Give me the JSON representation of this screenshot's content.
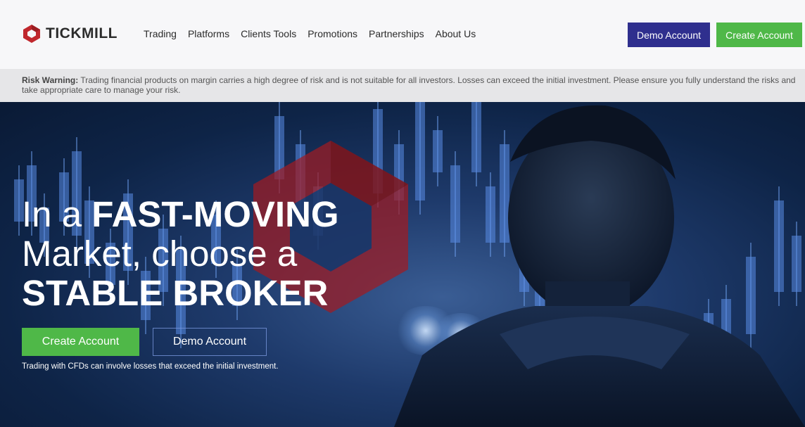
{
  "header": {
    "logo_text": "TICKMILL",
    "nav": [
      "Trading",
      "Platforms",
      "Clients Tools",
      "Promotions",
      "Partnerships",
      "About Us"
    ],
    "demo_label": "Demo Account",
    "create_label": "Create Account"
  },
  "risk": {
    "label": "Risk Warning:",
    "text": "Trading financial products on margin carries a high degree of risk and is not suitable for all investors. Losses can exceed the initial investment. Please ensure you fully understand the risks and take appropriate care to manage your risk."
  },
  "hero": {
    "line1_regular": "In a ",
    "line1_bold": "FAST-MOVING",
    "line2": "Market, choose a",
    "line3": "STABLE BROKER",
    "create_label": "Create Account",
    "demo_label": "Demo Account",
    "disclaimer": "Trading with CFDs can involve losses that exceed the initial investment."
  },
  "colors": {
    "brand_red": "#c0272d",
    "demo_blue": "#2f2f8e",
    "create_green": "#4fb848"
  }
}
